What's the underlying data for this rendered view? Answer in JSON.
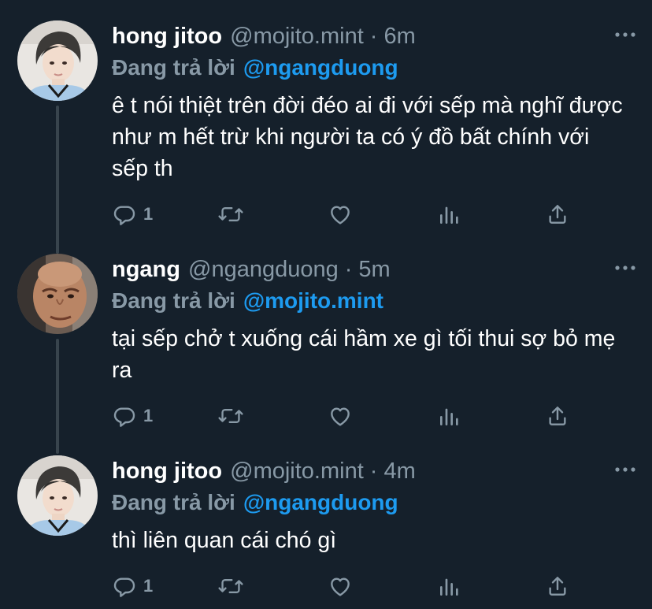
{
  "tweets": [
    {
      "name": "hong jitoo",
      "handle": "@mojito.mint",
      "dot": "·",
      "time": "6m",
      "reply_label": "Đang trả lời",
      "reply_user": "@ngangduong",
      "text": "ê t nói thiệt trên đời đéo ai đi với sếp mà nghĩ được như m hết trừ khi người ta có ý đồ bất chính với sếp th",
      "reply_count": "1"
    },
    {
      "name": "ngang",
      "handle": "@ngangduong",
      "dot": "·",
      "time": "5m",
      "reply_label": "Đang trả lời",
      "reply_user": "@mojito.mint",
      "text": "tại sếp chở t xuống cái hầm xe gì tối thui sợ bỏ mẹ ra",
      "reply_count": "1"
    },
    {
      "name": "hong jitoo",
      "handle": "@mojito.mint",
      "dot": "·",
      "time": "4m",
      "reply_label": "Đang trả lời",
      "reply_user": "@ngangduong",
      "text": "thì liên quan cái chó gì",
      "reply_count": "1"
    }
  ],
  "icons": {
    "reply": "reply-icon",
    "retweet": "retweet-icon",
    "like": "heart-icon",
    "analytics": "analytics-icon",
    "share": "share-icon",
    "more": "more-dots-icon"
  },
  "colors": {
    "background": "#15202b",
    "secondary_text": "#8899a6",
    "link": "#1d9bf0",
    "thread_line": "#38444d"
  }
}
